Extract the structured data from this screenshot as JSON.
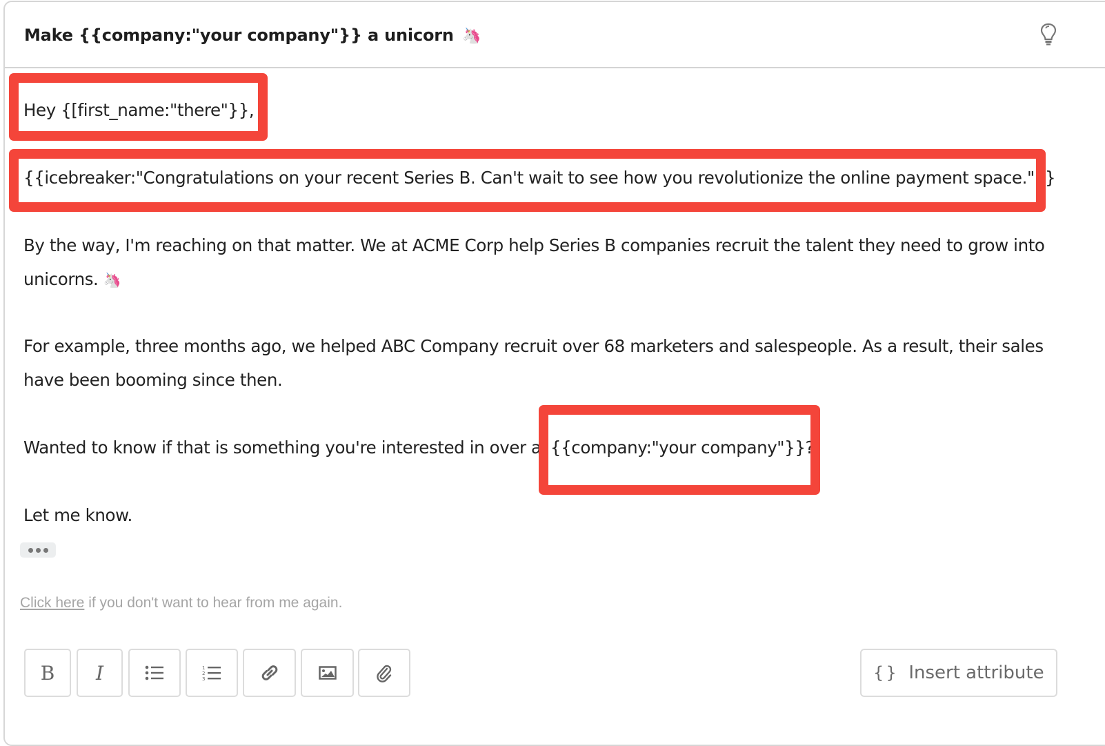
{
  "subject": {
    "text": "Make {{company:\"your company\"}} a unicorn",
    "emoji": "🦄",
    "hint_icon": "lightbulb-icon"
  },
  "body": {
    "greeting": "Hey {[first_name:\"there\"}},",
    "icebreaker": "{{icebreaker:\"Congratulations on your recent Series B. Can't wait to see how you revolutionize the online payment space.\"}}",
    "paragraph1_line1": "By the way, I'm reaching on that matter. We at ACME Corp help Series B companies recruit the talent they need to grow into",
    "paragraph1_line2": "unicorns.",
    "paragraph1_emoji": "🦄",
    "paragraph2_line1": "For example, three months ago, we helped ABC Company recruit over 68 marketers and salespeople. As a result, their sales",
    "paragraph2_line2": "have been booming since then.",
    "paragraph3_prefix": "Wanted to know if that is something you're interested in over at",
    "paragraph3_variable": "{{company:\"your company\"}}?",
    "closing": "Let me know.",
    "more_button": "more-icon"
  },
  "footer": {
    "unsubscribe_link": "Click here",
    "unsubscribe_text": " if you don't want to hear from me again."
  },
  "toolbar": {
    "buttons": [
      "bold",
      "italic",
      "bulleted-list",
      "numbered-list",
      "link",
      "image",
      "attachment"
    ],
    "bold_label": "B",
    "italic_label": "I",
    "insert_attribute_icon": "{}",
    "insert_attribute_label": "Insert attribute"
  },
  "colors": {
    "highlight": "#f4453a",
    "border": "#d6d6d6",
    "muted_text": "#a5a5a5"
  }
}
